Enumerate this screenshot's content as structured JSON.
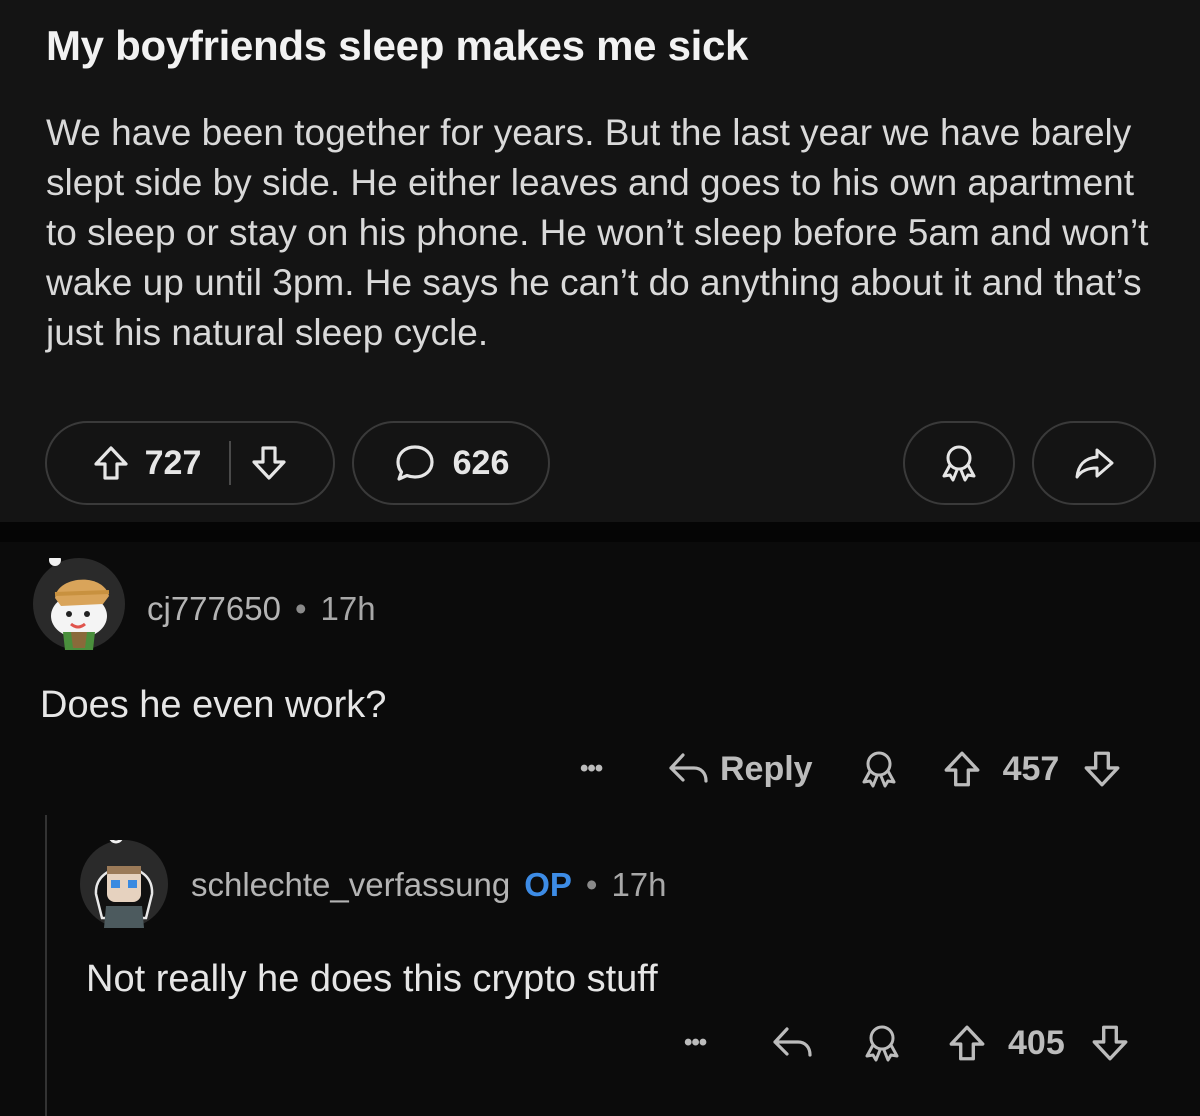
{
  "post": {
    "title": "My boyfriends sleep makes me sick",
    "body": "We have been together for years. But the last year we have barely slept side by side. He either leaves and goes to his own apartment to sleep or stay on his phone. He won’t sleep before 5am and won’t wake up until 3pm. He says he can’t do anything about it and that’s just his natural sleep cycle.",
    "upvotes": "727",
    "comments": "626"
  },
  "comments": [
    {
      "username": "cj777650",
      "time": "17h",
      "text": "Does he even work?",
      "more": "•••",
      "reply_label": "Reply",
      "votes": "457"
    },
    {
      "username": "schlechte_verfassung",
      "op_badge": "OP",
      "time": "17h",
      "text": "Not really he does this crypto stuff",
      "more": "•••",
      "votes": "405"
    }
  ],
  "colors": {
    "background": "#0b0b0b",
    "post_background": "#141414",
    "op_badge": "#3d8ce6"
  },
  "icons": {
    "upvote": "arrow-up-icon",
    "downvote": "arrow-down-icon",
    "comment": "speech-bubble-icon",
    "award": "award-ribbon-icon",
    "share": "share-arrow-icon",
    "reply": "reply-arrow-icon",
    "more": "ellipsis-icon"
  }
}
